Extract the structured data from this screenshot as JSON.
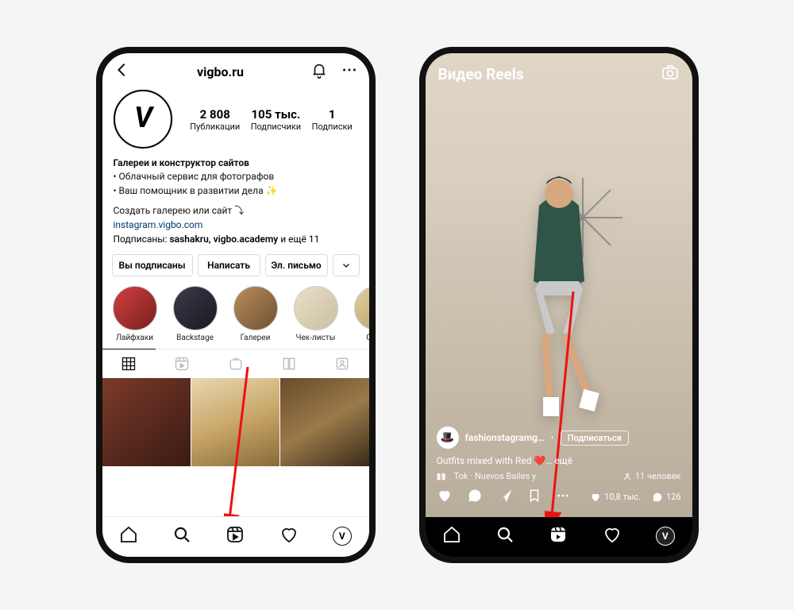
{
  "left": {
    "topbar": {
      "title": "vigbo.ru"
    },
    "avatar_letter": "V",
    "stats": {
      "posts": {
        "n": "2 808",
        "label": "Публикации"
      },
      "followers": {
        "n": "105 тыс.",
        "label": "Подписчики"
      },
      "following": {
        "n": "1",
        "label": "Подписки"
      }
    },
    "bio": {
      "name": "Галереи и конструктор сайтов",
      "line1": "• Облачный сервис для фотографов",
      "line2": "• Ваш помощник в развитии дела ✨",
      "cta": "Создать галерею или сайт ⤵",
      "link": "instagram.vigbo.com"
    },
    "followedby": {
      "prefix": "Подписаны: ",
      "names": "sashakru, vigbo.academy",
      "suffix": " и ещё 11"
    },
    "buttons": {
      "following": "Вы подписаны",
      "message": "Написать",
      "email": "Эл. письмо"
    },
    "highlights": [
      {
        "label": "Лайфхаки"
      },
      {
        "label": "Backstage"
      },
      {
        "label": "Галереи"
      },
      {
        "label": "Чек-листы"
      },
      {
        "label": "Отзы"
      }
    ]
  },
  "right": {
    "title": "Видео Reels",
    "user": {
      "name": "fashionstagramg…",
      "follow": "Подписаться"
    },
    "caption": "Outfits mixed with Red ❤️… ещё",
    "music_prefix": "Tok · Nuevos Bailes у",
    "people": "11 человек",
    "likes": "10,8 тыс.",
    "comments": "126"
  }
}
